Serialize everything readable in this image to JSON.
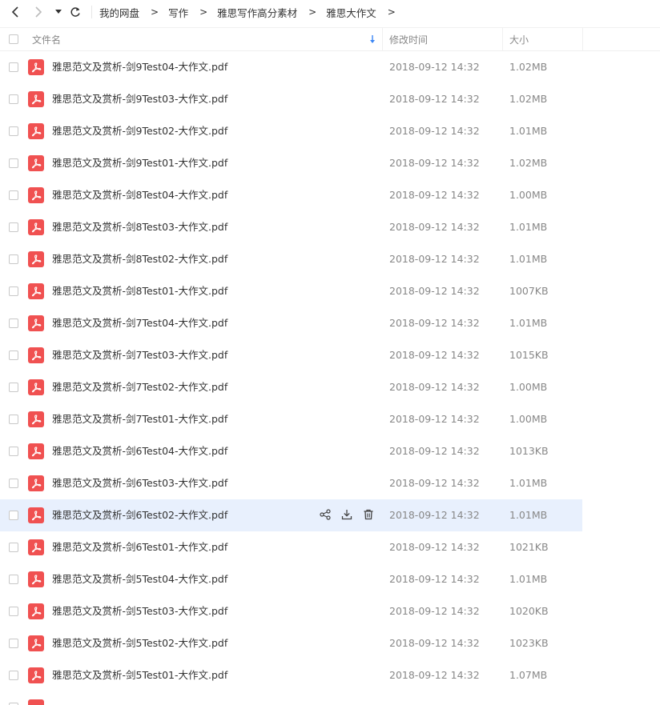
{
  "nav": {
    "back_icon": "chevron-left-icon",
    "forward_icon": "chevron-right-icon",
    "history_icon": "caret-down-icon",
    "refresh_icon": "refresh-icon"
  },
  "breadcrumb": [
    "我的网盘",
    "写作",
    "雅思写作高分素材",
    "雅思大作文"
  ],
  "header": {
    "name": "文件名",
    "modified": "修改时间",
    "size": "大小",
    "sort_icon": "sort-arrow-down-icon"
  },
  "colors": {
    "pdf_icon": "#f05151",
    "hover_row": "#e8f0fd",
    "sort_accent": "#3b86f5"
  },
  "files": [
    {
      "name": "雅思范文及赏析-剑9Test04-大作文.pdf",
      "time": "2018-09-12 14:32",
      "size": "1.02MB"
    },
    {
      "name": "雅思范文及赏析-剑9Test03-大作文.pdf",
      "time": "2018-09-12 14:32",
      "size": "1.02MB"
    },
    {
      "name": "雅思范文及赏析-剑9Test02-大作文.pdf",
      "time": "2018-09-12 14:32",
      "size": "1.01MB"
    },
    {
      "name": "雅思范文及赏析-剑9Test01-大作文.pdf",
      "time": "2018-09-12 14:32",
      "size": "1.02MB"
    },
    {
      "name": "雅思范文及赏析-剑8Test04-大作文.pdf",
      "time": "2018-09-12 14:32",
      "size": "1.00MB"
    },
    {
      "name": "雅思范文及赏析-剑8Test03-大作文.pdf",
      "time": "2018-09-12 14:32",
      "size": "1.01MB"
    },
    {
      "name": "雅思范文及赏析-剑8Test02-大作文.pdf",
      "time": "2018-09-12 14:32",
      "size": "1.01MB"
    },
    {
      "name": "雅思范文及赏析-剑8Test01-大作文.pdf",
      "time": "2018-09-12 14:32",
      "size": "1007KB"
    },
    {
      "name": "雅思范文及赏析-剑7Test04-大作文.pdf",
      "time": "2018-09-12 14:32",
      "size": "1.01MB"
    },
    {
      "name": "雅思范文及赏析-剑7Test03-大作文.pdf",
      "time": "2018-09-12 14:32",
      "size": "1015KB"
    },
    {
      "name": "雅思范文及赏析-剑7Test02-大作文.pdf",
      "time": "2018-09-12 14:32",
      "size": "1.00MB"
    },
    {
      "name": "雅思范文及赏析-剑7Test01-大作文.pdf",
      "time": "2018-09-12 14:32",
      "size": "1.00MB"
    },
    {
      "name": "雅思范文及赏析-剑6Test04-大作文.pdf",
      "time": "2018-09-12 14:32",
      "size": "1013KB"
    },
    {
      "name": "雅思范文及赏析-剑6Test03-大作文.pdf",
      "time": "2018-09-12 14:32",
      "size": "1.01MB"
    },
    {
      "name": "雅思范文及赏析-剑6Test02-大作文.pdf",
      "time": "2018-09-12 14:32",
      "size": "1.01MB",
      "hover": true
    },
    {
      "name": "雅思范文及赏析-剑6Test01-大作文.pdf",
      "time": "2018-09-12 14:32",
      "size": "1021KB"
    },
    {
      "name": "雅思范文及赏析-剑5Test04-大作文.pdf",
      "time": "2018-09-12 14:32",
      "size": "1.01MB"
    },
    {
      "name": "雅思范文及赏析-剑5Test03-大作文.pdf",
      "time": "2018-09-12 14:32",
      "size": "1020KB"
    },
    {
      "name": "雅思范文及赏析-剑5Test02-大作文.pdf",
      "time": "2018-09-12 14:32",
      "size": "1023KB"
    },
    {
      "name": "雅思范文及赏析-剑5Test01-大作文.pdf",
      "time": "2018-09-12 14:32",
      "size": "1.07MB"
    }
  ],
  "row_actions": [
    "share-icon",
    "download-icon",
    "trash-icon"
  ]
}
